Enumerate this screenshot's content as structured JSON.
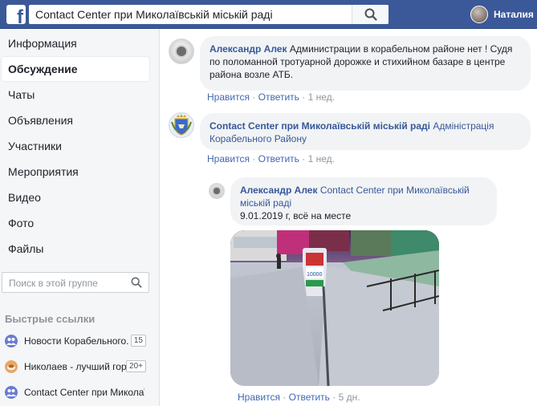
{
  "topbar": {
    "search_value": "Contact Center при Миколаївській міській раді",
    "user_name": "Наталия"
  },
  "sidebar": {
    "nav": [
      "Информация",
      "Обсуждение",
      "Чаты",
      "Объявления",
      "Участники",
      "Мероприятия",
      "Видео",
      "Фото",
      "Файлы"
    ],
    "active_index": 1,
    "search_placeholder": "Поиск в этой группе",
    "quick_links_title": "Быстрые ссылки",
    "quick_links": [
      {
        "label": "Новости Корабельного...",
        "badge": "15"
      },
      {
        "label": "Николаев - лучший город...",
        "badge": "20+"
      },
      {
        "label": "Contact Center при Миколаївській міській раді",
        "badge": ""
      }
    ]
  },
  "comments": [
    {
      "author": "Александр Алек",
      "text": "Администрации в корабельном районе нет ! Судя по поломанной тротуарной дорожке и стихийном базаре в центре района возле АТБ.",
      "like": "Нравится",
      "reply": "Ответить",
      "time": "1 нед."
    },
    {
      "author": "Contact Center при Миколаївській міській раді",
      "text": "Адміністрація Корабельного Району",
      "like": "Нравится",
      "reply": "Ответить",
      "time": "1 нед."
    },
    {
      "author": "Александр Алек",
      "mention": "Contact Center при Миколаївській міській раді",
      "text": "9.01.2019 г, всё на месте",
      "like": "Нравится",
      "reply": "Ответить",
      "time": "5 дн."
    }
  ]
}
